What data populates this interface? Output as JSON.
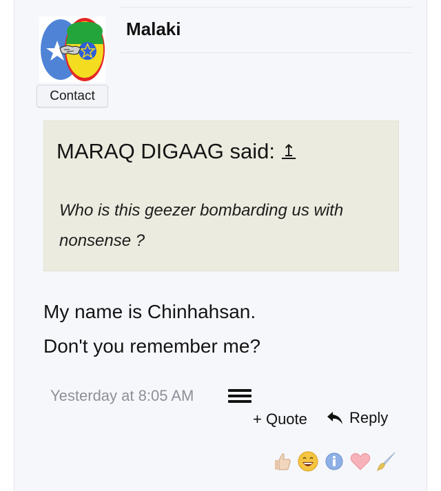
{
  "user": {
    "name": "Malaki",
    "contact_label": "Contact",
    "avatar_icon": "somalia-ethiopia-handshake-avatar"
  },
  "quote": {
    "author_line": "MARAQ DIGAAG said:",
    "jump_icon": "↥",
    "text": "Who is this geezer bombarding us with nonsense ?"
  },
  "message": {
    "lines": [
      "My name is Chinhahsan.",
      "Don't you remember me?"
    ]
  },
  "meta": {
    "timestamp": "Yesterday at 8:05 AM"
  },
  "actions": {
    "quote_label": "+ Quote",
    "reply_label": "Reply"
  },
  "reactions": [
    "thumbs-up-icon",
    "laughing-icon",
    "info-icon",
    "heart-icon",
    "brush-icon"
  ],
  "colors": {
    "post_bg": "#f6f7fb",
    "quote_bg": "#ecebdf",
    "timestamp": "#8d9098"
  }
}
